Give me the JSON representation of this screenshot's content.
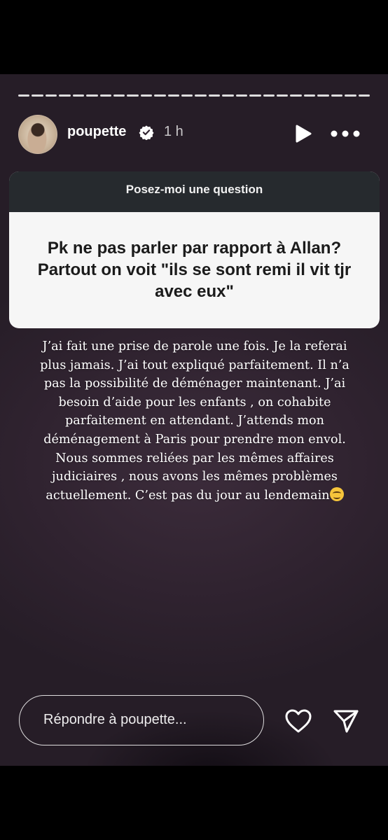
{
  "story": {
    "progress_segments": 26,
    "progress_viewed": 26
  },
  "header": {
    "username": "poupette",
    "verified": true,
    "time": "1 h",
    "icons": [
      "play-icon",
      "more-icon",
      "verified-badge-icon"
    ]
  },
  "question_box": {
    "prompt": "Posez-moi une question",
    "question": "Pk ne pas parler par rapport à Allan? Partout on voit \"ils se sont remi il vit tjr avec eux\""
  },
  "answer": {
    "lines": [
      "J’ai fait une prise de parole une fois. Je la referai",
      "plus jamais. J’ai tout expliqué parfaitement. Il n’a",
      "pas la possibilité de déménager maintenant. J’ai",
      "besoin d’aide pour les enfants , on cohabite",
      "parfaitement en attendant. J’attends mon",
      "déménagement à Paris pour prendre mon envol.",
      "Nous sommes reliées par les mêmes affaires",
      "judiciaires , nous avons les mêmes problèmes",
      "actuellement. C’est pas du jour au lendemain"
    ],
    "emoji": "smiling-face-emoji"
  },
  "footer": {
    "reply_placeholder": "Répondre à poupette...",
    "icons": [
      "heart-icon",
      "send-icon"
    ]
  },
  "colors": {
    "background": "#000000",
    "story_bg": "#302330",
    "question_header": "#262a2e",
    "question_body": "#f6f6f6"
  }
}
